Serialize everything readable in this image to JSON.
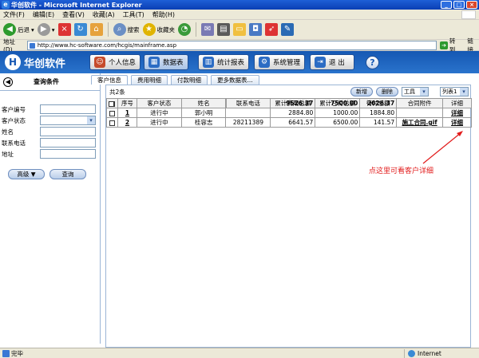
{
  "window": {
    "title": "华创软件 - Microsoft Internet Explorer"
  },
  "menu": [
    "文件(F)",
    "编辑(E)",
    "查看(V)",
    "收藏(A)",
    "工具(T)",
    "帮助(H)"
  ],
  "toolbar": {
    "back": "后退",
    "search": "搜索",
    "favorites": "收藏夹"
  },
  "address": {
    "label": "地址(D)",
    "url": "http://www.hc-software.com/hcgis/mainframe.asp",
    "go": "转到",
    "links": "链接"
  },
  "app": {
    "logo": "华创软件",
    "nav": [
      "个人信息",
      "数据表",
      "统计报表",
      "系统管理",
      "退  出"
    ],
    "help": "?"
  },
  "left_panel": {
    "title": "查询条件",
    "fields": [
      "客户编号",
      "客户状态",
      "姓名",
      "联系电话",
      "地址"
    ],
    "advanced_button": "高级 ▼",
    "query_button": "查询"
  },
  "tabs": [
    "客户信息",
    "费用明细",
    "付款明细",
    "更多数据表..."
  ],
  "grid_toolbar": {
    "count": "共2条",
    "add": "新增",
    "delete": "删除",
    "tools": "工具",
    "view": "列表1"
  },
  "grid": {
    "columns": [
      "序号",
      "客户状态",
      "姓名",
      "联系电话",
      "累计费用总额",
      "累计已付总额",
      "待付总额",
      "合同附件",
      "详细"
    ],
    "rows": [
      {
        "no": "1",
        "status": "进行中",
        "name": "郭小明",
        "phone": "",
        "total_fee": "2884.80",
        "paid": "1000.00",
        "due": "1884.80",
        "attachment": "",
        "detail": "详细"
      },
      {
        "no": "2",
        "status": "进行中",
        "name": "桂容志",
        "phone": "28211389",
        "total_fee": "6641.57",
        "paid": "6500.00",
        "due": "141.57",
        "attachment": "施工合同.gif",
        "detail": "详细"
      }
    ],
    "totals": {
      "total_fee": "9526.37",
      "paid": "7500.00",
      "due": "2026.37"
    }
  },
  "annotation": "点这里可看客户详细",
  "status": {
    "left": "完毕",
    "zone": "Internet"
  }
}
